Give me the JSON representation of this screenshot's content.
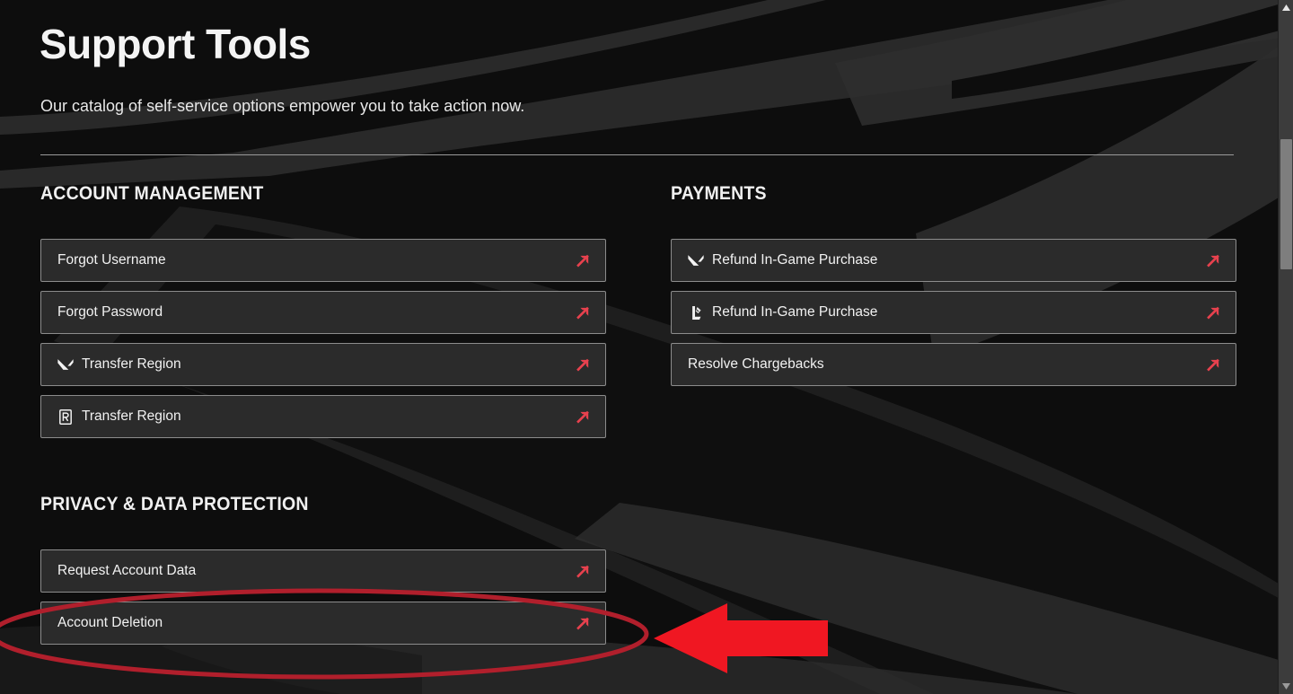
{
  "page": {
    "title": "Support Tools",
    "subtitle": "Our catalog of self-service options empower you to take action now."
  },
  "colors": {
    "background": "#141414",
    "background_swoosh": "#2e2e2e",
    "row_fill": "#2b2b2b",
    "row_border": "#8c8c8c",
    "text_primary": "#f2f2f2",
    "arrow_accent": "#e8414e",
    "annotation_ellipse": "#b11f2c",
    "annotation_arrow": "#f01722",
    "scrollbar_track": "#3c3c3c",
    "scrollbar_thumb": "#7e7e7e"
  },
  "sections": [
    {
      "id": "account-management",
      "title": "ACCOUNT MANAGEMENT",
      "column": "left",
      "rows": [
        {
          "label": "Forgot Username",
          "game_icon": null,
          "arrow_icon": "external-link-arrow-icon"
        },
        {
          "label": "Forgot Password",
          "game_icon": null,
          "arrow_icon": "external-link-arrow-icon"
        },
        {
          "label": "Transfer Region",
          "game_icon": "valorant-icon",
          "arrow_icon": "external-link-arrow-icon"
        },
        {
          "label": "Transfer Region",
          "game_icon": "wild-rift-icon",
          "arrow_icon": "external-link-arrow-icon"
        }
      ]
    },
    {
      "id": "privacy-data-protection",
      "title": "PRIVACY & DATA PROTECTION",
      "column": "left",
      "rows": [
        {
          "label": "Request Account Data",
          "game_icon": null,
          "arrow_icon": "external-link-arrow-icon"
        },
        {
          "label": "Account Deletion",
          "game_icon": null,
          "arrow_icon": "external-link-arrow-icon"
        }
      ]
    },
    {
      "id": "payments",
      "title": "PAYMENTS",
      "column": "right",
      "rows": [
        {
          "label": "Refund In-Game Purchase",
          "game_icon": "valorant-icon",
          "arrow_icon": "external-link-arrow-icon"
        },
        {
          "label": "Refund In-Game Purchase",
          "game_icon": "league-of-legends-icon",
          "arrow_icon": "external-link-arrow-icon"
        },
        {
          "label": "Resolve Chargebacks",
          "game_icon": null,
          "arrow_icon": "external-link-arrow-icon"
        }
      ]
    }
  ],
  "annotations": {
    "ellipse": {
      "name": "highlight-ellipse",
      "target": "Account Deletion"
    },
    "arrow": {
      "name": "pointer-arrow",
      "direction": "left"
    }
  },
  "scrollbar": {
    "up_arrow": "scroll-up-arrow-icon",
    "down_arrow": "scroll-down-arrow-icon"
  }
}
